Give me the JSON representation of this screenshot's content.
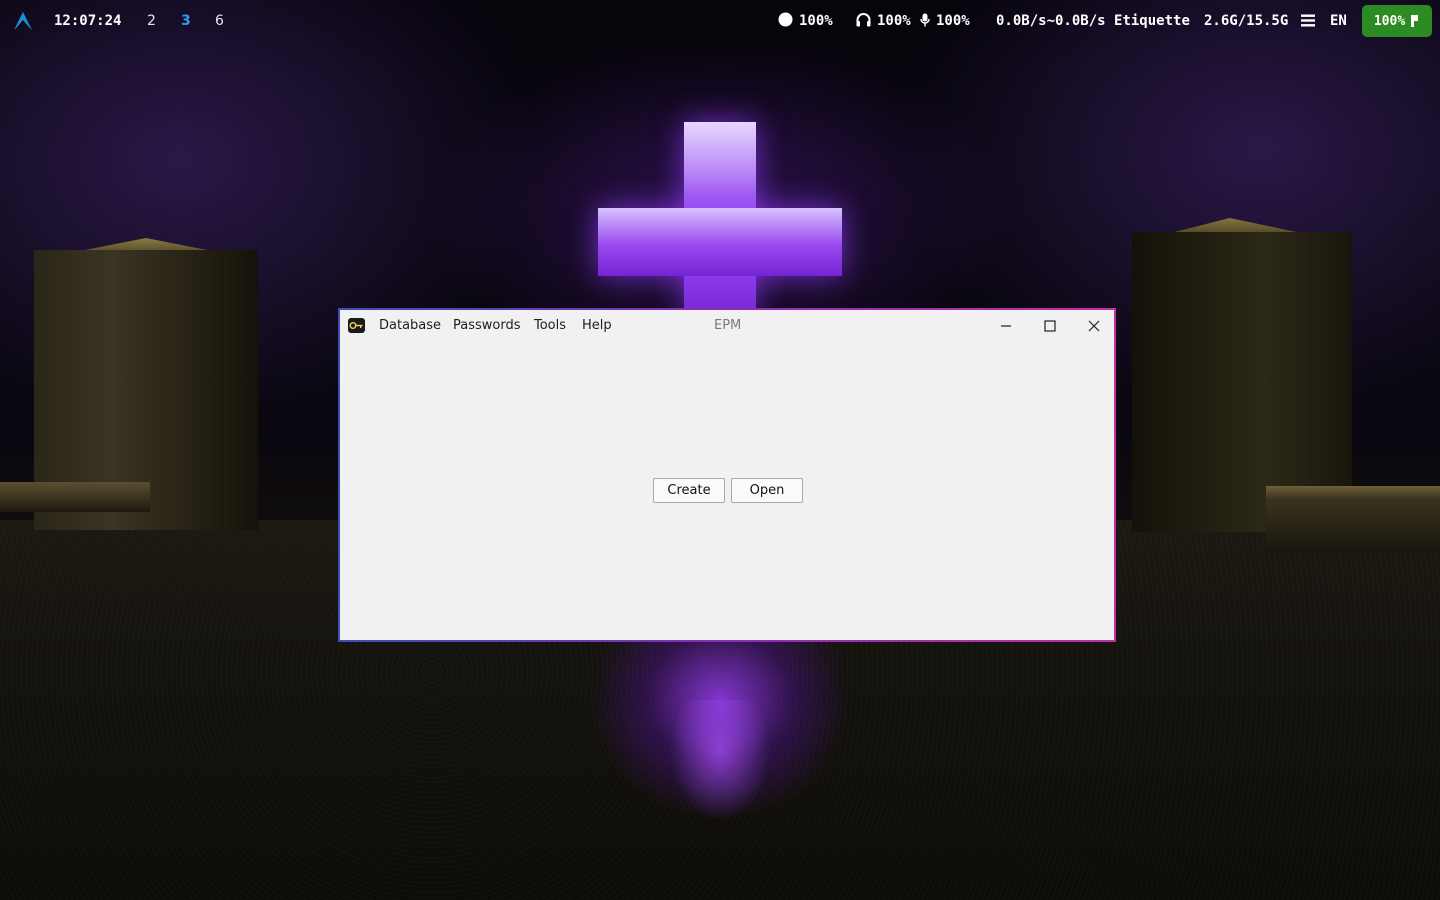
{
  "topbar": {
    "clock": "12:07:24",
    "workspaces": [
      "2",
      "3",
      "6"
    ],
    "active_workspace": "3",
    "brightness": "100%",
    "headphones_volume": "100%",
    "mic_volume": "100%",
    "network_speed": "0.0B/s~0.0B/s",
    "network_name": "Etiquette",
    "memory": "2.6G/15.5G",
    "keyboard_layout": "EN",
    "battery": "100%",
    "colors": {
      "active_workspace": "#2f9cf0",
      "battery_bg": "#2c8b22",
      "arch_logo": "#1793d1"
    }
  },
  "window": {
    "title": "EPM",
    "app_icon": "key-icon",
    "menu": [
      "Database",
      "Passwords",
      "Tools",
      "Help"
    ],
    "controls": [
      "minimize-icon",
      "maximize-icon",
      "close-icon"
    ],
    "buttons": {
      "create": "Create",
      "open": "Open"
    }
  }
}
